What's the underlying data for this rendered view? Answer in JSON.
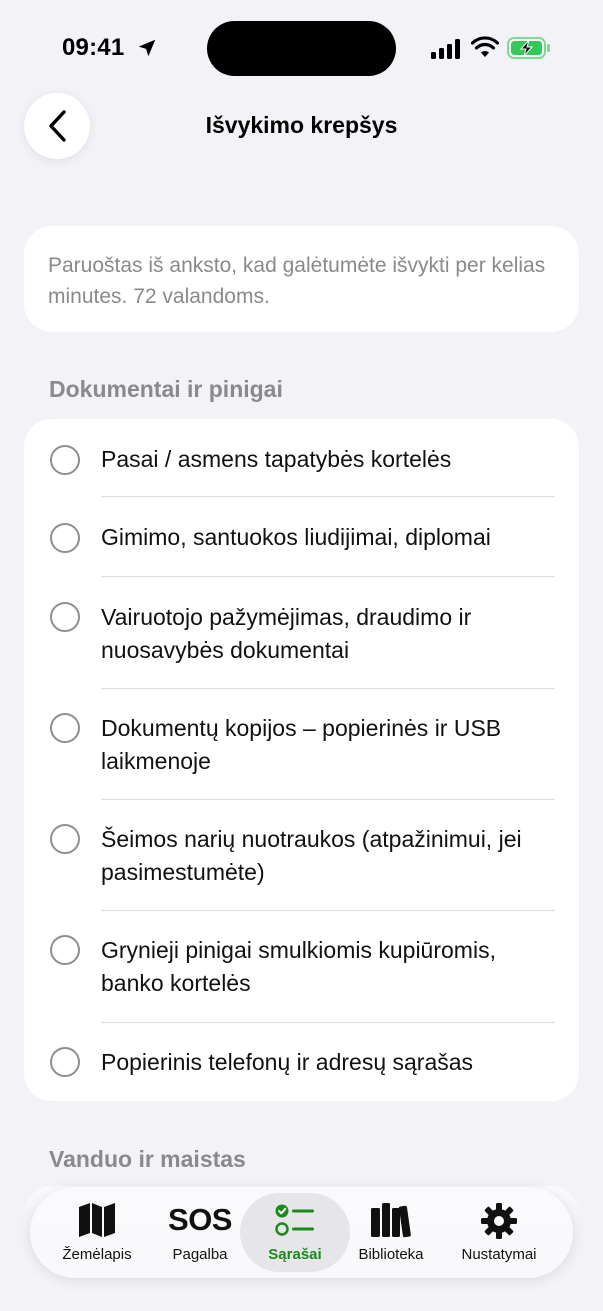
{
  "status_bar": {
    "time": "09:41"
  },
  "header": {
    "title": "Išvykimo krepšys"
  },
  "intro": {
    "text": "Paruoštas iš anksto, kad galėtumėte išvykti per kelias minutes. 72 valandoms."
  },
  "sections": [
    {
      "label": "Dokumentai ir pinigai",
      "items": [
        {
          "label": "Pasai / asmens tapatybės kortelės",
          "checked": false
        },
        {
          "label": "Gimimo, santuokos liudijimai, diplomai",
          "checked": false
        },
        {
          "label": "Vairuotojo pažymėjimas, draudimo ir nuosavybės dokumentai",
          "checked": false
        },
        {
          "label": "Dokumentų kopijos – popierinės ir USB laikmenoje",
          "checked": false
        },
        {
          "label": "Šeimos narių nuotraukos (atpažinimui, jei pasimestumėte)",
          "checked": false
        },
        {
          "label": "Grynieji pinigai smulkiomis kupiūromis, banko kortelės",
          "checked": false
        },
        {
          "label": "Popierinis telefonų ir adresų sąrašas",
          "checked": false
        }
      ]
    },
    {
      "label": "Vanduo ir maistas",
      "items": []
    }
  ],
  "tabs": [
    {
      "label": "Žemėlapis",
      "icon": "map-icon",
      "active": false
    },
    {
      "label": "Pagalba",
      "icon": "sos-icon",
      "icon_text": "SOS",
      "active": false
    },
    {
      "label": "Sąrašai",
      "icon": "checklist-icon",
      "active": true
    },
    {
      "label": "Biblioteka",
      "icon": "books-icon",
      "active": false
    },
    {
      "label": "Nustatymai",
      "icon": "gear-icon",
      "active": false
    }
  ],
  "colors": {
    "accent": "#1a8a1a",
    "background": "#f2f2f7",
    "secondary_text": "#8a8a8e"
  }
}
